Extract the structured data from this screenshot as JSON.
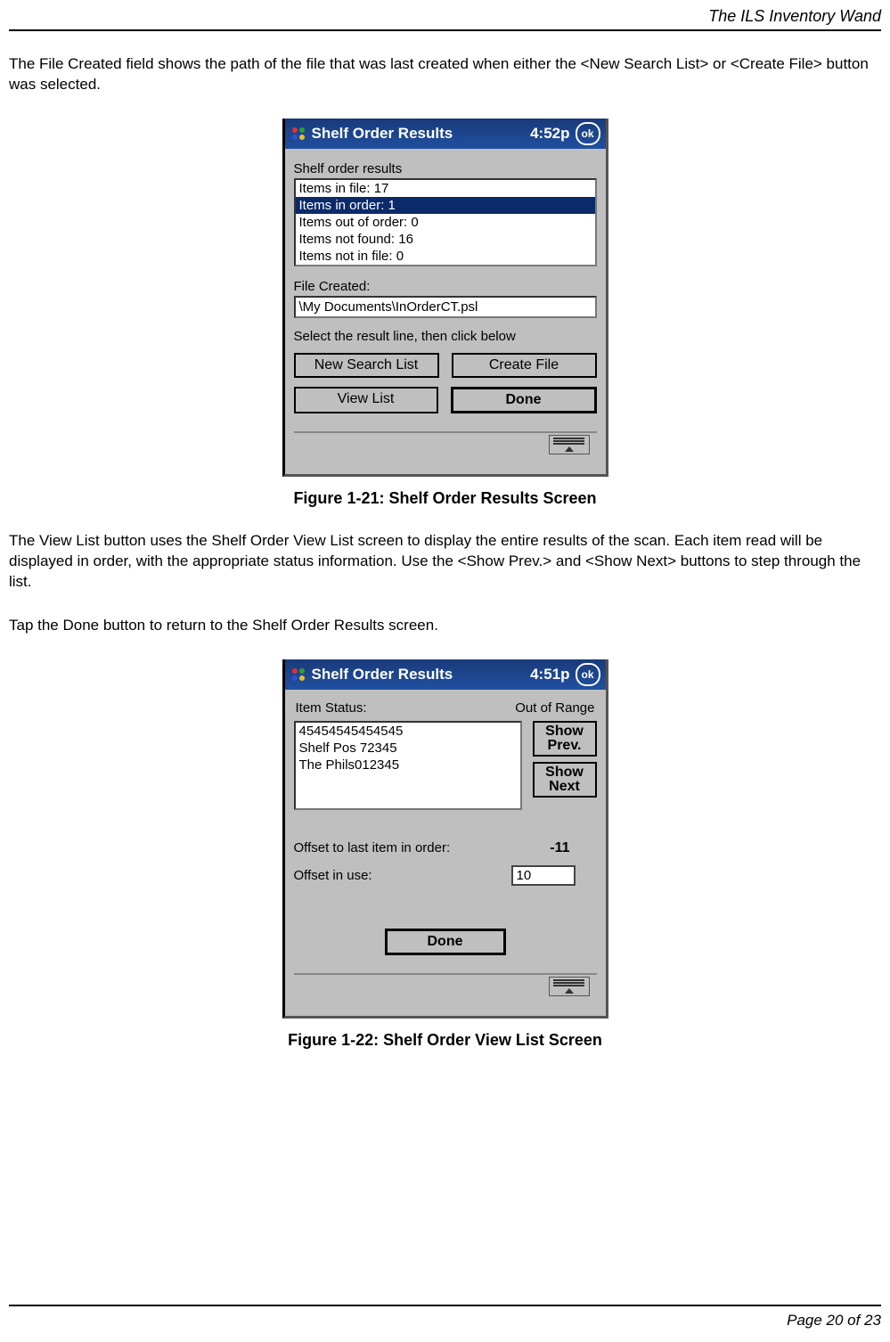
{
  "running_head": "The ILS Inventory Wand",
  "para1": "The File Created field shows the path of the file that was last created when either the <New Search List> or <Create File> button was selected.",
  "fig1": {
    "titlebar": {
      "title": "Shelf Order Results",
      "time": "4:52p",
      "ok": "ok"
    },
    "results_label": "Shelf order results",
    "results": [
      "Items in file: 17",
      "Items in order: 1",
      "Items out of order: 0",
      "Items not found: 16",
      "Items not in file: 0"
    ],
    "selected_index": 1,
    "file_created_label": "File Created:",
    "file_created_path": "\\My Documents\\InOrderCT.psl",
    "instruction": "Select the result line, then click below",
    "btn_new_search": "New Search List",
    "btn_create_file": "Create File",
    "btn_view_list": "View List",
    "btn_done": "Done",
    "caption": "Figure 1-21: Shelf Order Results Screen"
  },
  "para2": "The View List button uses the Shelf Order View List screen to display the entire results of the scan. Each item read will be displayed in order, with the appropriate status information. Use the <Show Prev.> and <Show Next> buttons to step through the list.",
  "para3": "Tap the Done button to return to the Shelf Order Results screen.",
  "fig2": {
    "titlebar": {
      "title": "Shelf Order Results",
      "time": "4:51p",
      "ok": "ok"
    },
    "item_status_label": "Item Status:",
    "item_status_value": "Out of Range",
    "details": [
      "45454545454545",
      "Shelf Pos 72345",
      "The Phils012345"
    ],
    "btn_show_prev_l1": "Show",
    "btn_show_prev_l2": "Prev.",
    "btn_show_next_l1": "Show",
    "btn_show_next_l2": "Next",
    "offset_last_label": "Offset to last item in order:",
    "offset_last_value": "-11",
    "offset_use_label": "Offset in use:",
    "offset_use_value": "10",
    "btn_done": "Done",
    "caption": "Figure 1-22: Shelf Order View List Screen"
  },
  "footer_page": "Page 20 of 23"
}
